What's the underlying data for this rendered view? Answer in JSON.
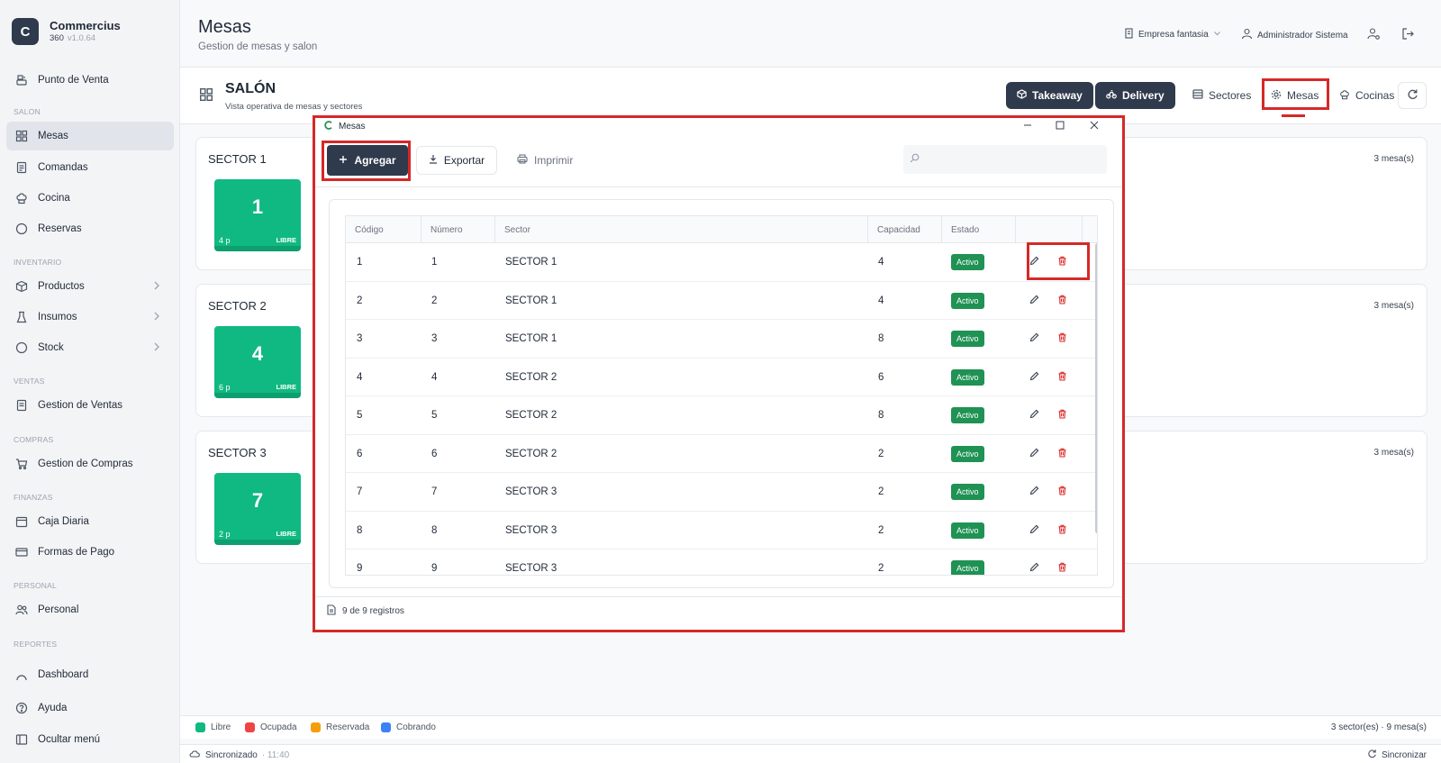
{
  "app": {
    "name": "Commercius",
    "edition": "360",
    "version": "v1.0.64",
    "logo_letter": "C"
  },
  "sidebar": {
    "sections": {
      "salon": "SALON",
      "inventario": "INVENTARIO",
      "ventas": "VENTAS",
      "compras": "COMPRAS",
      "finanzas": "FINANZAS",
      "personal": "PERSONAL",
      "reportes": "REPORTES"
    },
    "items": {
      "punto_venta": "Punto de Venta",
      "mesas": "Mesas",
      "comandas": "Comandas",
      "cocina": "Cocina",
      "reservas": "Reservas",
      "productos": "Productos",
      "insumos": "Insumos",
      "stock": "Stock",
      "gestion_ventas": "Gestion de Ventas",
      "gestion_compras": "Gestion de Compras",
      "caja_diaria": "Caja Diaria",
      "formas_pago": "Formas de Pago",
      "personal": "Personal",
      "dashboard": "Dashboard",
      "ayuda": "Ayuda",
      "ocultar_menu": "Ocultar menú"
    },
    "active": "mesas"
  },
  "header": {
    "title": "Mesas",
    "subtitle": "Gestion de mesas y salon",
    "company": "Empresa fantasia",
    "user": "Administrador Sistema"
  },
  "salon": {
    "title": "SALÓN",
    "subtitle": "Vista operativa de mesas y sectores",
    "buttons": {
      "takeaway": "Takeaway",
      "delivery": "Delivery",
      "sectores": "Sectores",
      "mesas": "Mesas",
      "cocinas": "Cocinas"
    }
  },
  "sectors": [
    {
      "name": "SECTOR 1",
      "count": "3  mesa(s)",
      "first_table": {
        "number": "1",
        "capacity": "4 p",
        "status": "LIBRE"
      }
    },
    {
      "name": "SECTOR 2",
      "count": "3  mesa(s)",
      "first_table": {
        "number": "4",
        "capacity": "6 p",
        "status": "LIBRE"
      }
    },
    {
      "name": "SECTOR 3",
      "count": "3  mesa(s)",
      "first_table": {
        "number": "7",
        "capacity": "2 p",
        "status": "LIBRE"
      }
    }
  ],
  "legend": {
    "items": [
      {
        "label": "Libre",
        "color": "#10b981"
      },
      {
        "label": "Ocupada",
        "color": "#ef4444"
      },
      {
        "label": "Reservada",
        "color": "#f59e0b"
      },
      {
        "label": "Cobrando",
        "color": "#3b82f6"
      }
    ],
    "summary": "3 sector(es) · 9 mesa(s)"
  },
  "status": {
    "sync_label": "Sincronizado",
    "sync_time": "· 11:40",
    "sync_button": "Sincronizar"
  },
  "modal": {
    "title": "Mesas",
    "toolbar": {
      "add": "Agregar",
      "export": "Exportar",
      "print": "Imprimir",
      "search_placeholder": ""
    },
    "columns": [
      "Código",
      "Número",
      "Sector",
      "Capacidad",
      "Estado"
    ],
    "rows": [
      {
        "codigo": "1",
        "numero": "1",
        "sector": "SECTOR 1",
        "capacidad": "4",
        "estado": "Activo"
      },
      {
        "codigo": "2",
        "numero": "2",
        "sector": "SECTOR 1",
        "capacidad": "4",
        "estado": "Activo"
      },
      {
        "codigo": "3",
        "numero": "3",
        "sector": "SECTOR 1",
        "capacidad": "8",
        "estado": "Activo"
      },
      {
        "codigo": "4",
        "numero": "4",
        "sector": "SECTOR 2",
        "capacidad": "6",
        "estado": "Activo"
      },
      {
        "codigo": "5",
        "numero": "5",
        "sector": "SECTOR 2",
        "capacidad": "8",
        "estado": "Activo"
      },
      {
        "codigo": "6",
        "numero": "6",
        "sector": "SECTOR 2",
        "capacidad": "2",
        "estado": "Activo"
      },
      {
        "codigo": "7",
        "numero": "7",
        "sector": "SECTOR 3",
        "capacidad": "2",
        "estado": "Activo"
      },
      {
        "codigo": "8",
        "numero": "8",
        "sector": "SECTOR 3",
        "capacidad": "2",
        "estado": "Activo"
      },
      {
        "codigo": "9",
        "numero": "9",
        "sector": "SECTOR 3",
        "capacidad": "2",
        "estado": "Activo"
      }
    ],
    "footer": "9 de 9 registros"
  },
  "colors": {
    "highlight": "#d62828",
    "dark_button": "#2f3a4c",
    "active_badge": "#1f9254",
    "table_free": "#10b981",
    "delete_icon": "#dc2626"
  }
}
